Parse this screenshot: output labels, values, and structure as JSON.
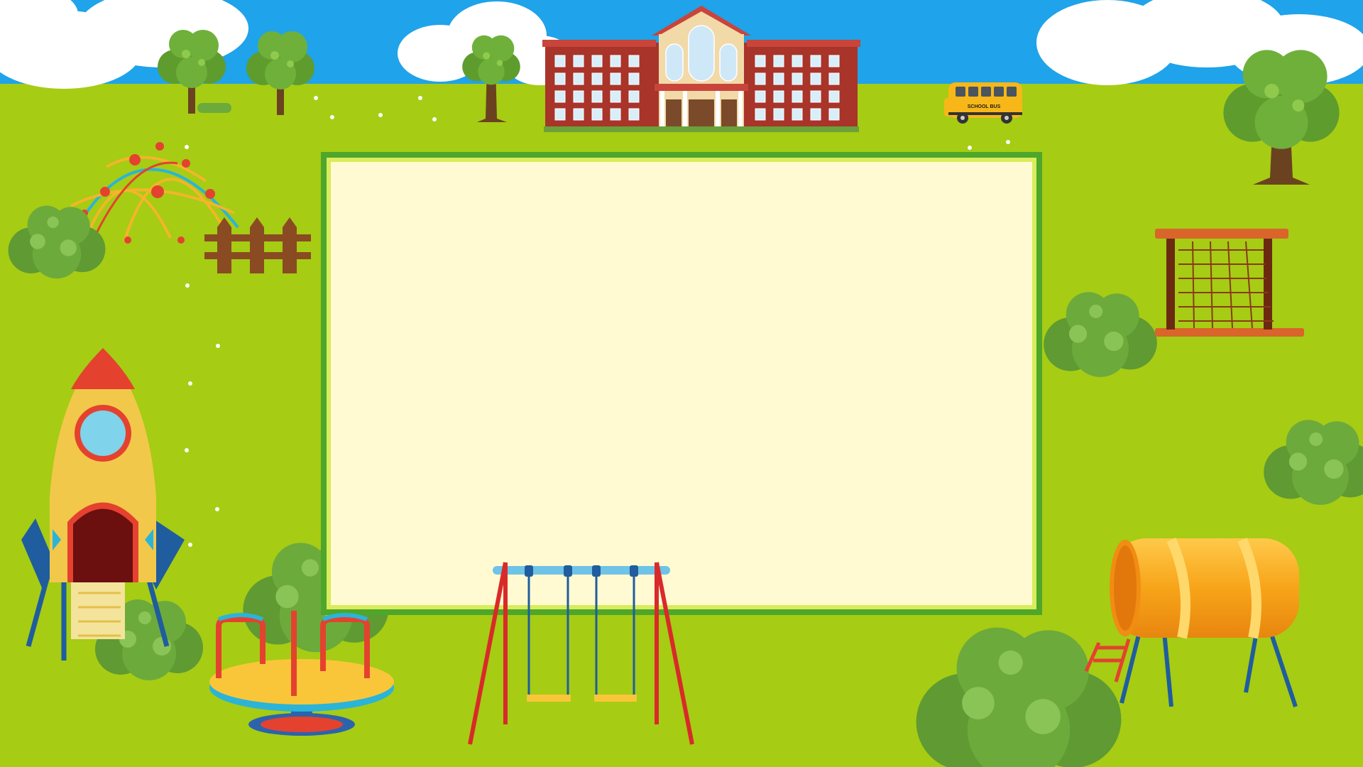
{
  "scene": {
    "kind": "school playground frame",
    "bus_label": "SCHOOL BUS",
    "board_text": ""
  },
  "colors": {
    "sky": "#1fa3ea",
    "grass": "#a6cc14",
    "board_fill": "#fffad2",
    "board_border": "#4ea62a",
    "brick": "#a8342a",
    "bus": "#f7b718",
    "rocket": "#f2c84a",
    "tunnel": "#f7a419",
    "bush": "#6aa13a"
  },
  "icons": [
    "tree-icon",
    "school-building-icon",
    "school-bus-icon",
    "dome-climber-icon",
    "fence-icon",
    "rocket-slide-icon",
    "merry-go-round-icon",
    "swing-set-icon",
    "rope-net-climber-icon",
    "tube-slide-icon",
    "bush-icon"
  ]
}
